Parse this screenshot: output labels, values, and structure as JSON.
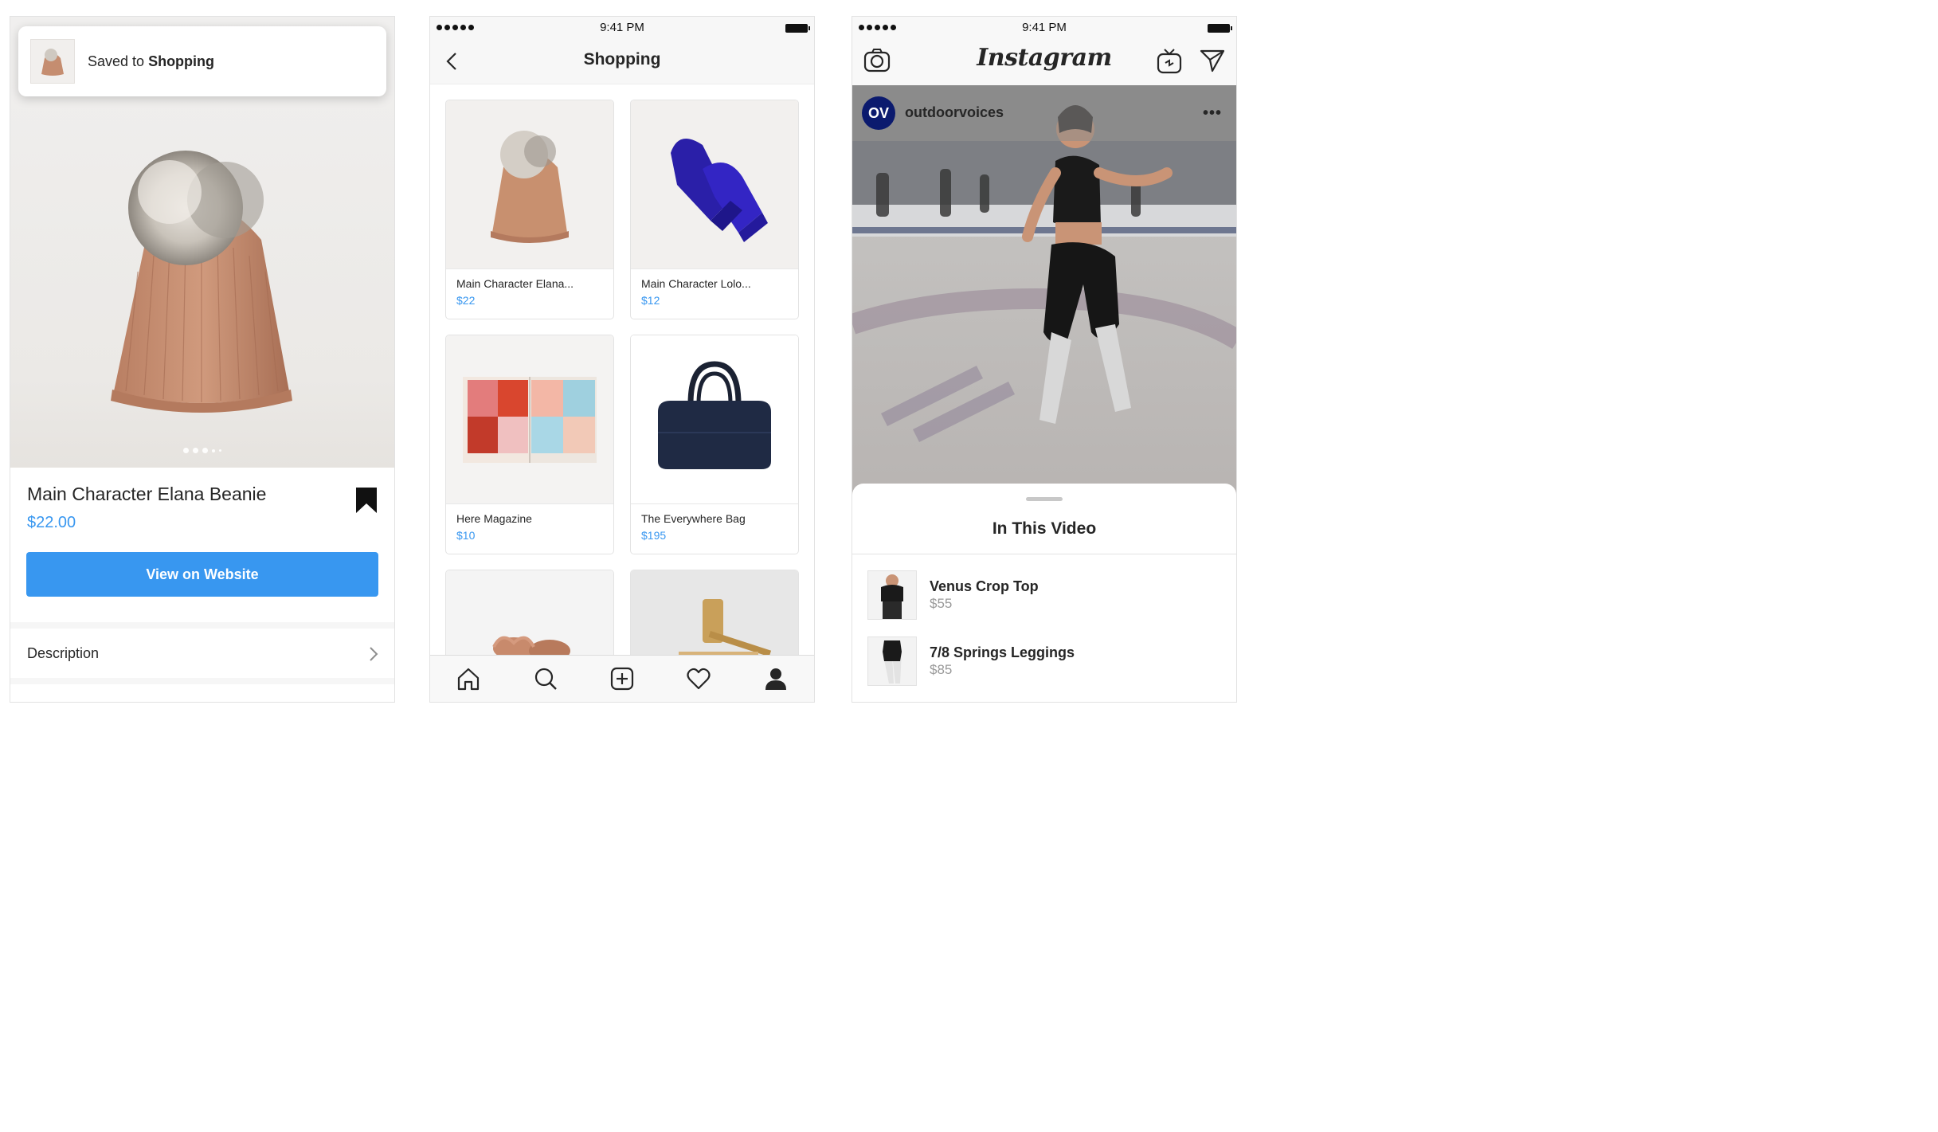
{
  "status": {
    "time": "9:41 PM"
  },
  "phone1": {
    "toast": {
      "prefix": "Saved to ",
      "collection": "Shopping"
    },
    "product": {
      "title": "Main Character Elana Beanie",
      "price": "$22.00"
    },
    "cta_label": "View on Website",
    "description_label": "Description"
  },
  "phone2": {
    "title": "Shopping",
    "items": [
      {
        "name": "Main Character Elana...",
        "price": "$22"
      },
      {
        "name": "Main Character Lolo...",
        "price": "$12"
      },
      {
        "name": "Here Magazine",
        "price": "$10"
      },
      {
        "name": "The Everywhere Bag",
        "price": "$195"
      }
    ]
  },
  "phone3": {
    "logo": "Instagram",
    "account": {
      "avatar_initials": "OV",
      "username": "outdoorvoices"
    },
    "sheet_title": "In This Video",
    "products": [
      {
        "name": "Venus Crop Top",
        "price": "$55"
      },
      {
        "name": "7/8 Springs Leggings",
        "price": "$85"
      }
    ]
  },
  "colors": {
    "accent": "#3897f0",
    "text": "#262626",
    "muted": "#999999"
  }
}
